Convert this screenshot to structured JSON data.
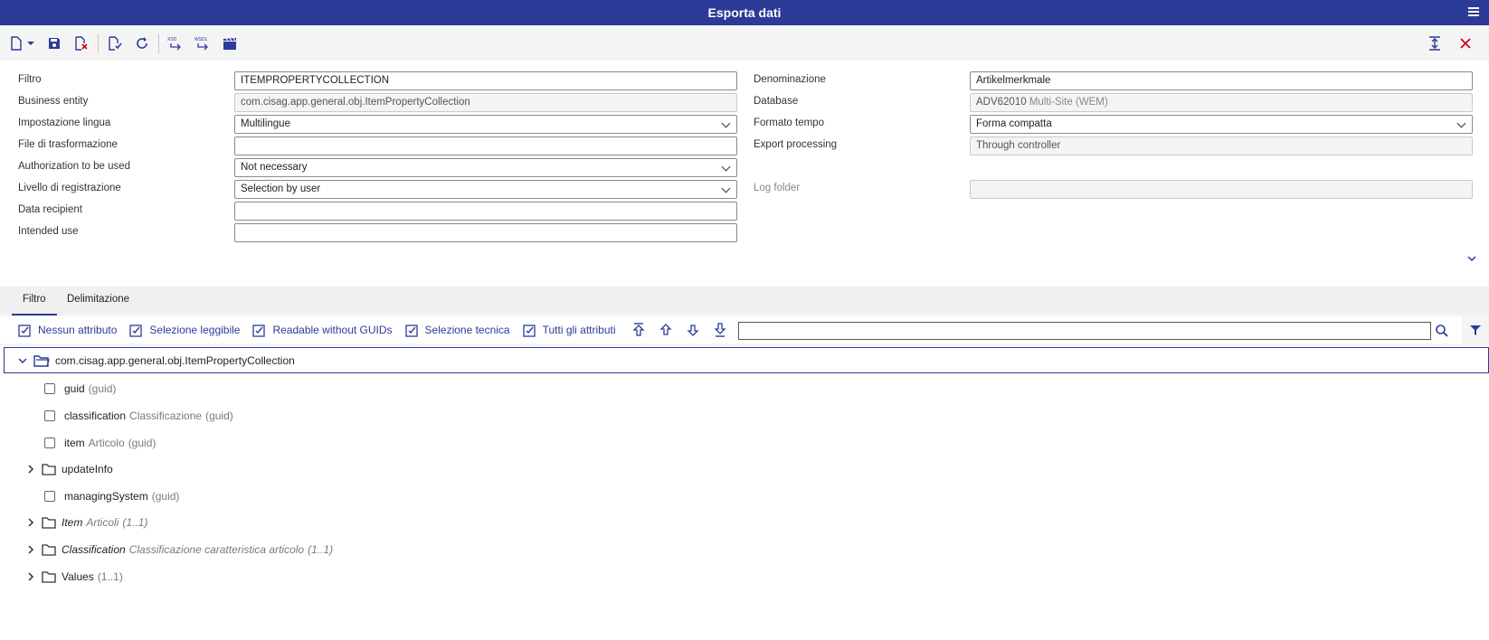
{
  "window": {
    "title": "Esporta dati"
  },
  "form": {
    "left": [
      {
        "label": "Filtro",
        "value": "ITEMPROPERTYCOLLECTION",
        "type": "text"
      },
      {
        "label": "Business entity",
        "value": "com.cisag.app.general.obj.ItemPropertyCollection",
        "type": "readonly"
      },
      {
        "label": "Impostazione lingua",
        "value": "Multilingue",
        "type": "select"
      },
      {
        "label": "File di trasformazione",
        "value": "",
        "type": "text"
      },
      {
        "label": "Authorization to be used",
        "value": "Not necessary",
        "type": "select"
      },
      {
        "label": "Livello di registrazione",
        "value": "Selection by user",
        "type": "select"
      },
      {
        "label": "Data recipient",
        "value": "",
        "type": "text"
      },
      {
        "label": "Intended use",
        "value": "",
        "type": "text"
      }
    ],
    "right": {
      "denominazione": {
        "label": "Denominazione",
        "value": "Artikelmerkmale"
      },
      "database": {
        "label": "Database",
        "value": "ADV62010",
        "sub": "Multi-Site (WEM)"
      },
      "formato_tempo": {
        "label": "Formato tempo",
        "value": "Forma compatta"
      },
      "export_processing": {
        "label": "Export processing",
        "value": "Through controller"
      },
      "log_folder": {
        "label": "Log folder",
        "value": ""
      }
    }
  },
  "tabs": [
    "Filtro",
    "Delimitazione"
  ],
  "filter_buttons": [
    "Nessun attributo",
    "Selezione leggibile",
    "Readable without GUIDs",
    "Selezione tecnica",
    "Tutti gli attributi"
  ],
  "search": {
    "value": ""
  },
  "tree": {
    "root": "com.cisag.app.general.obj.ItemPropertyCollection",
    "rows": [
      {
        "kind": "attr",
        "name": "guid",
        "desc": "",
        "type": "(guid)"
      },
      {
        "kind": "attr",
        "name": "classification",
        "desc": "Classificazione",
        "type": "(guid)"
      },
      {
        "kind": "attr",
        "name": "item",
        "desc": "Articolo",
        "type": "(guid)"
      },
      {
        "kind": "folder",
        "name": "updateInfo",
        "desc": "",
        "type": ""
      },
      {
        "kind": "attr",
        "name": "managingSystem",
        "desc": "",
        "type": "(guid)"
      },
      {
        "kind": "folder-italic",
        "name": "Item",
        "desc": "Articoli",
        "type": "(1..1)"
      },
      {
        "kind": "folder-italic",
        "name": "Classification",
        "desc": "Classificazione caratteristica articolo",
        "type": "(1..1)"
      },
      {
        "kind": "folder",
        "name": "Values",
        "desc": "",
        "type": "(1..1)"
      }
    ]
  },
  "colors": {
    "accent": "#2b3b97",
    "close": "#d0021b"
  }
}
